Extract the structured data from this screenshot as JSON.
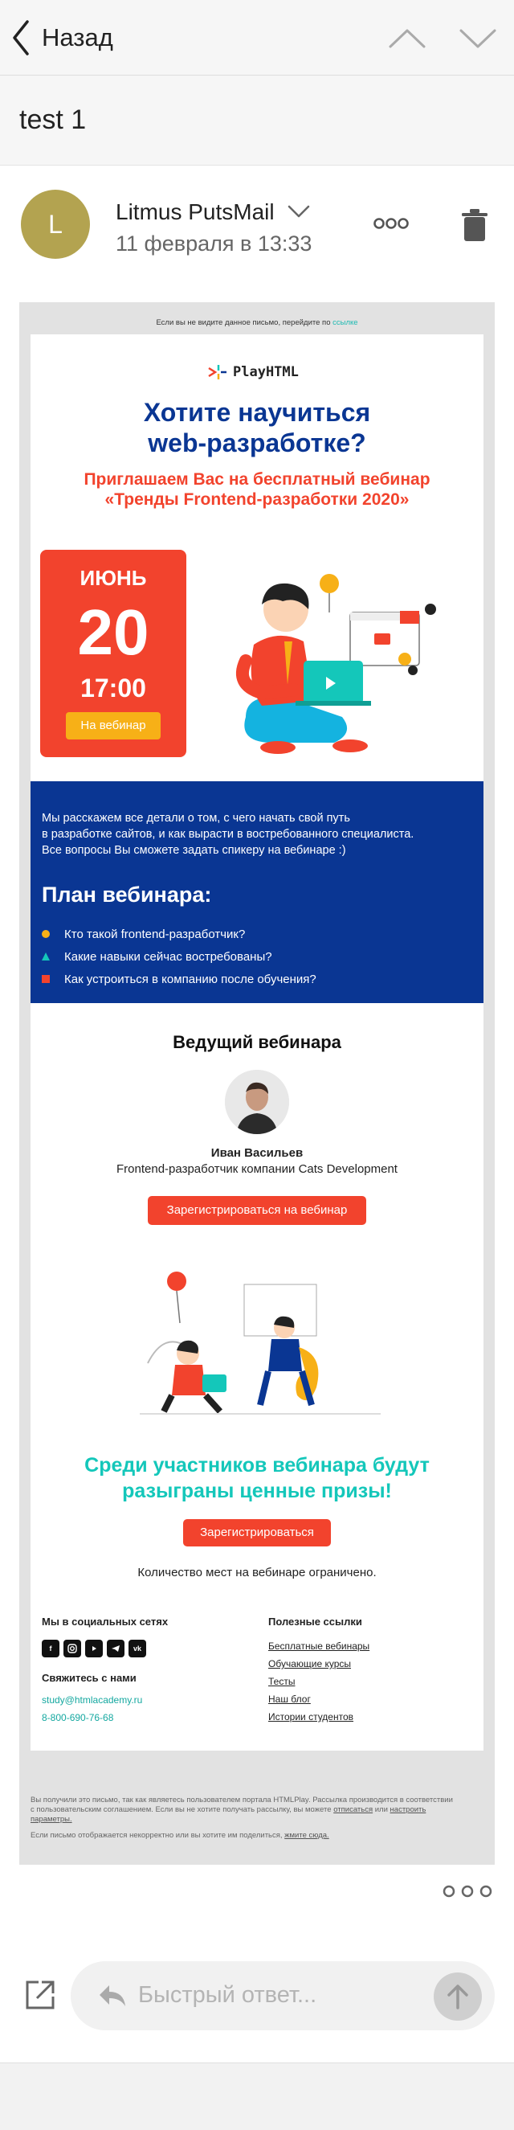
{
  "nav": {
    "back_label": "Назад"
  },
  "subject": "test 1",
  "sender": {
    "initial": "L",
    "name": "Litmus PutsMail",
    "date": "11 февраля в 13:33"
  },
  "email": {
    "preheader_text": "Если вы не видите данное письмо, перейдите по",
    "preheader_link": "ссылке",
    "logo_text": "PlayHTML",
    "headline_line1": "Хотите научиться",
    "headline_line2": "web-разработке?",
    "subheadline": "Приглашаем Вас на бесплатный вебинар «Тренды Frontend-разработки 2020»",
    "date_month": "ИЮНЬ",
    "date_day": "20",
    "date_time": "17:00",
    "date_button": "На вебинар",
    "intro_line1": "Мы расскажем все детали о том, с чего начать свой путь",
    "intro_line2": "в разработке сайтов, и как вырасти в востребованного специалиста.",
    "intro_line3": "Все вопросы Вы сможете задать спикеру на вебинаре :)",
    "plan_title": "План вебинара:",
    "plan_items": [
      "Кто такой frontend-разработчик?",
      "Какие навыки сейчас востребованы?",
      "Как устроиться в компанию после обучения?"
    ],
    "host_title": "Ведущий вебинара",
    "host_name": "Иван Васильев",
    "host_role": "Frontend-разработчик компании Cats Development",
    "register_button": "Зарегистрироваться на вебинар",
    "prize_line1": "Среди участников вебинара будут",
    "prize_line2": "разыграны ценные призы!",
    "register_button_2": "Зарегистрироваться",
    "limited_text": "Количество мест на вебинаре ограничено.",
    "social_title": "Мы в социальных сетях",
    "contact_title": "Свяжитесь с нами",
    "contact_email": "study@htmlacademy.ru",
    "contact_phone": "8-800-690-76-68",
    "links_title": "Полезные ссылки",
    "links": [
      "Бесплатные вебинары",
      "Обучающие курсы",
      "Тесты",
      "Наш блог",
      "Истории студентов"
    ],
    "legal_line1": "Вы получили это письмо, так как являетесь пользователем портала HTMLPlay. Рассылка производится в соответствии",
    "legal_line2a": "с пользовательским соглашением. Если вы не хотите получать рассылку, вы можете",
    "legal_unsub": "отписаться",
    "legal_or": "или",
    "legal_settings": "настроить",
    "legal_params": "параметры.",
    "legal_line3": "Если письмо отображается некорректно или вы хотите им поделиться,",
    "legal_link3": "жмите сюда."
  },
  "reply": {
    "placeholder": "Быстрый ответ..."
  },
  "colors": {
    "brand_blue": "#0a3693",
    "accent_red": "#f2432d",
    "teal": "#14c7ba",
    "yellow": "#f7b017"
  }
}
